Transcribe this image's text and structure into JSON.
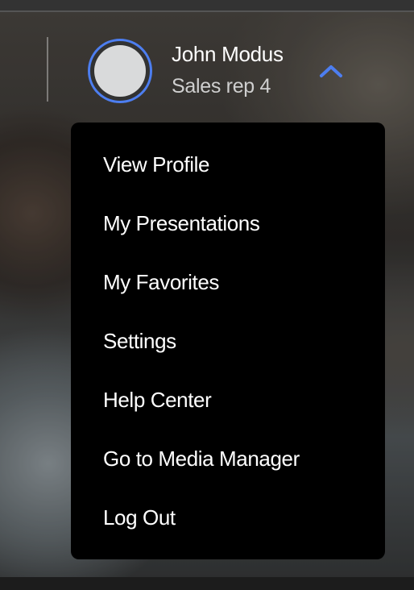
{
  "user": {
    "name": "John Modus",
    "role": "Sales rep 4"
  },
  "icons": {
    "toggle": "chevron-up-icon",
    "avatar": "avatar-placeholder"
  },
  "colors": {
    "accent": "#4d7ef0",
    "menu_background": "#000000",
    "avatar_fill": "#d9dadb"
  },
  "menu": {
    "items": [
      {
        "label": "View Profile"
      },
      {
        "label": "My Presentations"
      },
      {
        "label": "My Favorites"
      },
      {
        "label": "Settings"
      },
      {
        "label": "Help Center"
      },
      {
        "label": "Go to Media Manager"
      },
      {
        "label": "Log Out"
      }
    ]
  }
}
